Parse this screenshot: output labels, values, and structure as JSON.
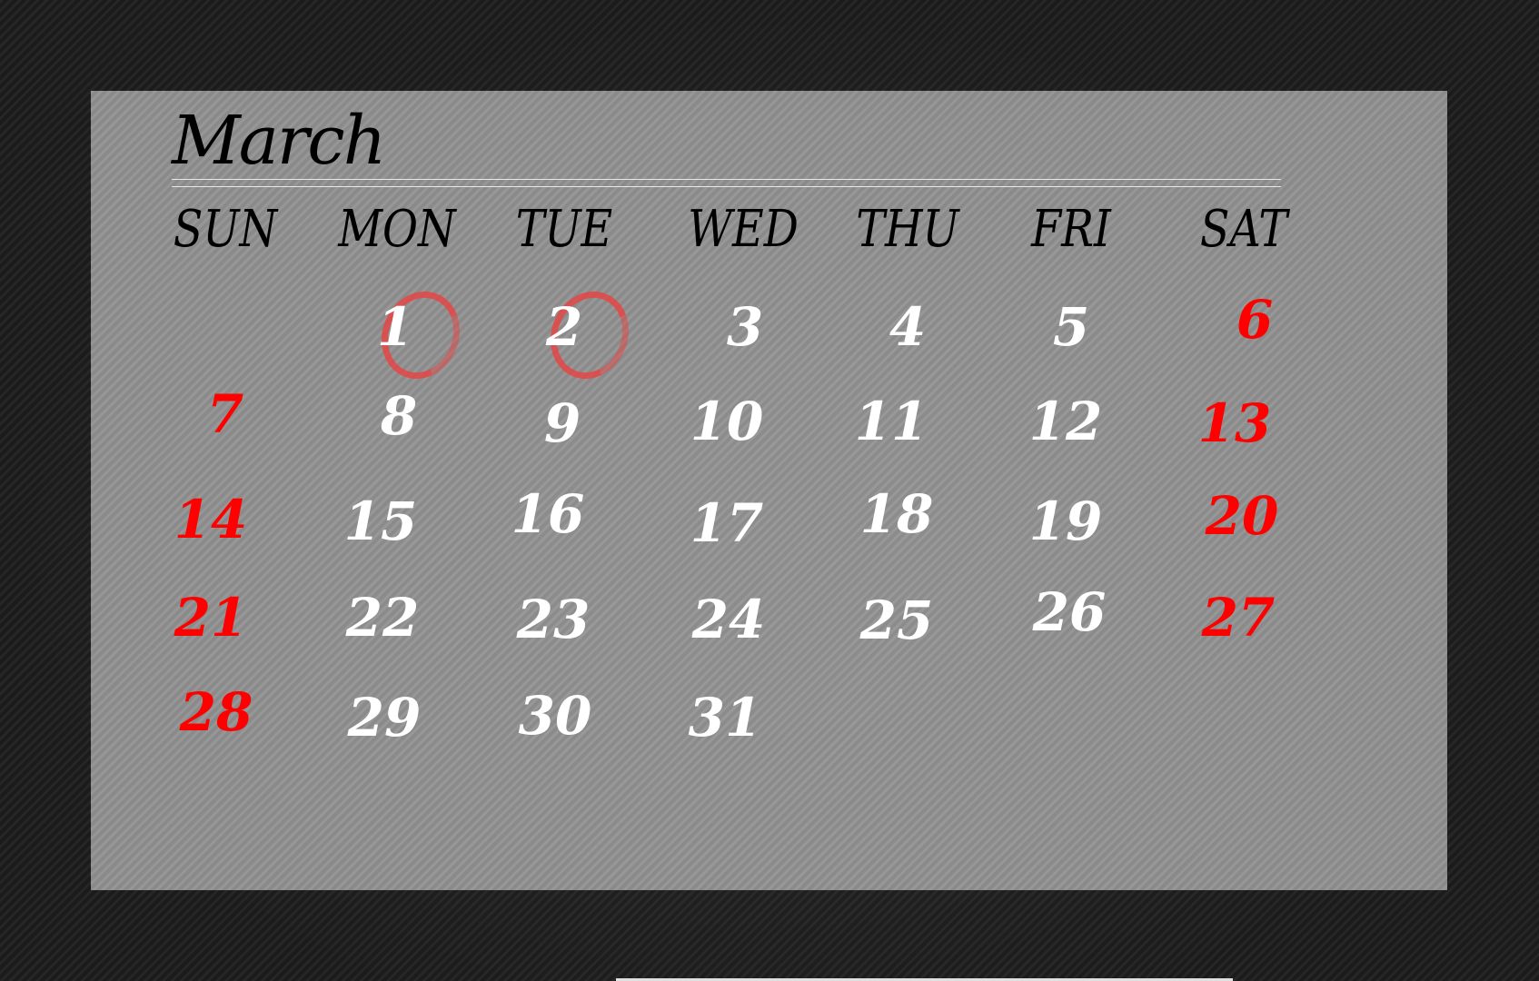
{
  "calendar": {
    "month": "March",
    "weekdays": [
      "SUN",
      "MON",
      "TUE",
      "WED",
      "THU",
      "FRI",
      "SAT"
    ],
    "weekend_color": "#ff0000",
    "marked_days": [
      "1",
      "2"
    ],
    "mark_color": "#f03c3c",
    "rows": [
      [
        "",
        "1",
        "2",
        "3",
        "4",
        "5",
        "6"
      ],
      [
        "7",
        "8",
        "9",
        "10",
        "11",
        "12",
        "13"
      ],
      [
        "14",
        "15",
        "16",
        "17",
        "18",
        "19",
        "20"
      ],
      [
        "21",
        "22",
        "23",
        "24",
        "25",
        "26",
        "27"
      ],
      [
        "28",
        "29",
        "30",
        "31",
        "",
        "",
        ""
      ]
    ]
  }
}
